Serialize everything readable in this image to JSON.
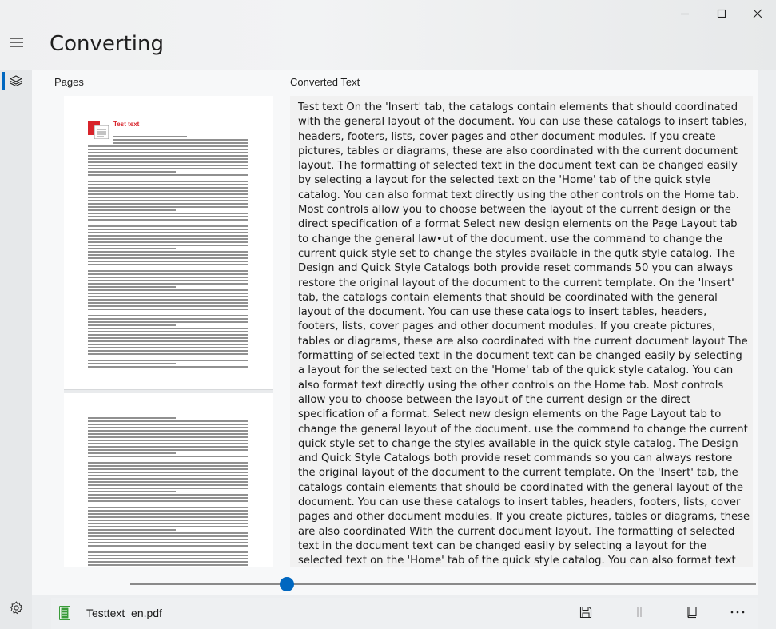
{
  "window": {
    "title": "Converting",
    "minimize_icon": "minimize-icon",
    "maximize_icon": "maximize-icon",
    "close_icon": "close-icon"
  },
  "nav": {
    "menu_icon": "hamburger-icon",
    "layers_icon": "layers-icon",
    "settings_icon": "gear-icon"
  },
  "pages_panel": {
    "label": "Pages",
    "page1_heading": "Test text"
  },
  "text_panel": {
    "label": "Converted Text",
    "content": "Test text On the 'Insert' tab, the catalogs contain elements that should coordinated with the general layout of the document. You can use these catalogs to insert tables, headers, footers, lists, cover pages and other document modules. If you create pictures, tables or diagrams, these are also coordinated with the current document layout. The formatting of selected text in the document text can be changed easily by selecting a layout for the selected text on the 'Home' tab of the quick style catalog. You can also format text directly using the other controls on the Home tab. Most controls allow you to choose between the layout of the current design or the direct specification of a format Select new design elements on the Page Layout tab to change the general law•ut of the document. use the command to change the current quick style set to change the styles available in the qutk style catalog. The Design and Quick Style Catalogs both provide reset commands 50 you can always restore the original layout of the document to the current template. On the 'Insert' tab, the catalogs contain elements that should be coordinated with the general layout of the document. You can use these catalogs to insert tables, headers, footers, lists, cover pages and other document modules. If you create pictures, tables or diagrams, these are also coordinated with the current document layout The formatting of selected text in the document text can be changed easily by selecting a layout for the selected text on the 'Home' tab of the quick style catalog. You can also format text directly using the other controls on the Home tab. Most controls allow you to choose between the layout of the current design or the direct specification of a format. Select new design elements on the Page Layout tab to change the general layout of the document. use the command to change the current quick style set to change the styles available in the quick style catalog. The Design and Quick Style Catalogs both provide reset commands so you can always restore the original layout of the document to the current template. On the 'Insert' tab, the catalogs contain elements that should be coordinated with the general layout of the document. You can use these catalogs to insert tables, headers, footers, lists, cover pages and other document modules. If you create pictures, tables or diagrams, these are also coordinated With the current document layout. The formatting of selected text in the document text can be changed easily by selecting a layout for the selected text on the 'Home' tab of the quick style catalog. You can also format text directly using the other controls on the Home tab. Most controls allow you to choose between the layout of the current design or the direct specification of a format. Select new design elements on the Page Layout tab to change the general layout of the document. use"
  },
  "slider": {
    "value_fraction": 0.25
  },
  "bottom_bar": {
    "file_icon": "document-icon",
    "file_name": "Testtext_en.pdf",
    "save_icon": "save-icon",
    "split_icon": "split-icon",
    "book_icon": "book-icon",
    "more_icon": "more-icon"
  },
  "colors": {
    "accent": "#0067c0",
    "pdf_red": "#d8242b",
    "file_green": "#3a9b3a"
  }
}
